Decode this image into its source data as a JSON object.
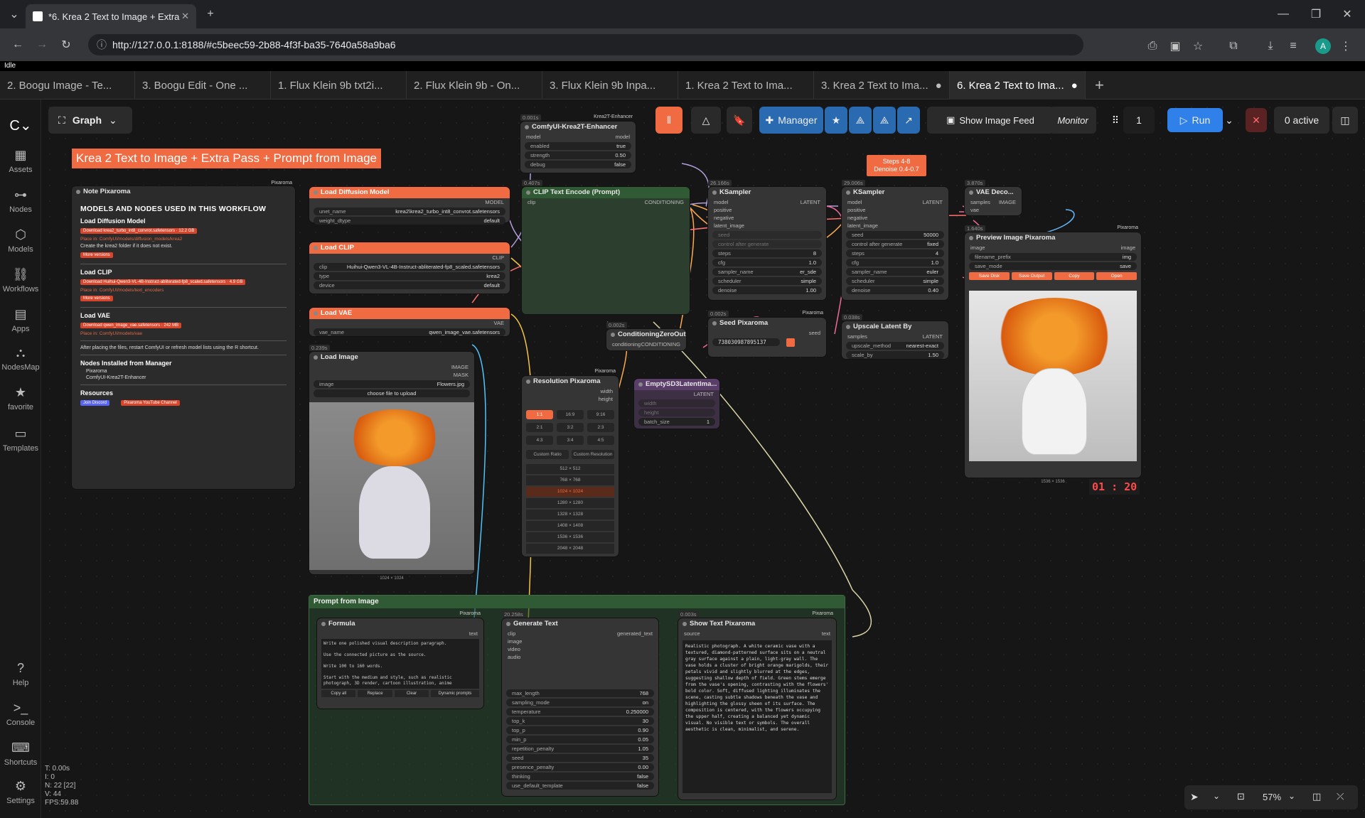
{
  "browser": {
    "tab_title": "*6. Krea 2 Text to Image + Extra",
    "url": "http://127.0.0.1:8188/#c5beec59-2b88-4f3f-ba35-7640a58a9ba6",
    "profile_initial": "A"
  },
  "status_text": "Idle",
  "workflow_tabs": [
    "2. Boogu Image - Te...",
    "3. Boogu Edit - One ...",
    "1. Flux Klein 9b txt2i...",
    "2. Flux Klein 9b - On...",
    "3. Flux Klein 9b Inpa...",
    "1. Krea 2 Text to Ima...",
    "3. Krea 2 Text to Ima...",
    "6. Krea 2 Text to Ima..."
  ],
  "sidebar": [
    {
      "label": "Assets",
      "icon": "assets-icon"
    },
    {
      "label": "Nodes",
      "icon": "nodes-icon"
    },
    {
      "label": "Models",
      "icon": "models-icon"
    },
    {
      "label": "Workflows",
      "icon": "workflows-icon"
    },
    {
      "label": "Apps",
      "icon": "apps-icon"
    },
    {
      "label": "NodesMap",
      "icon": "nodesmap-icon"
    },
    {
      "label": "favorite",
      "icon": "star-icon"
    },
    {
      "label": "Templates",
      "icon": "templates-icon"
    }
  ],
  "sidebar_bottom": [
    {
      "label": "Help"
    },
    {
      "label": "Console"
    },
    {
      "label": "Shortcuts"
    },
    {
      "label": "Settings"
    }
  ],
  "graph_label": "Graph",
  "toolbar": {
    "manager": "Manager",
    "feed": "Show Image Feed",
    "monitor": "Monitor",
    "queue_count": "1",
    "run": "Run",
    "active": "0 active"
  },
  "title_banner": "Krea 2 Text to Image + Extra Pass + Prompt from Image",
  "note": {
    "header": "Note Pixaroma",
    "brand": "Pixaroma",
    "heading": "MODELS AND NODES USED IN THIS WORKFLOW",
    "s1": "Load Diffusion Model",
    "s1_dl": "Download krea2_turbo_int8_convrot.safetensors · 12.2 GB",
    "s1_place": "Place in: ComfyUI/models/diffusion_models/krea2",
    "s1_note": "Create the  krea2  folder if it does not exist.",
    "more": "More versions",
    "s2": "Load CLIP",
    "s2_dl": "Download Huihui-Qwen3-VL-4B-Instruct-abliterated-fp8_scaled.safetensors · 4.9 GB",
    "s2_place": "Place in: ComfyUI/models/text_encoders",
    "s3": "Load VAE",
    "s3_dl": "Download qwen_image_vae.safetensors · 242 MB",
    "s3_place": "Place in: ComfyUI/models/vae",
    "warn": "After placing the files, restart ComfyUI or refresh model lists using the R shortcut.",
    "s4": "Nodes Installed from Manager",
    "n1": "Pixaroma",
    "n2": "ComfyUI-Krea2T-Enhancer",
    "s5": "Resources",
    "r1": "Join Discord",
    "r2": "Pixaroma YouTube Channel"
  },
  "nodes": {
    "enhancer": {
      "title": "ComfyUI-Krea2T-Enhancer",
      "time": "0.001s",
      "brand": "Krea2T-Enhancer",
      "in": "model",
      "out": "model",
      "enabled": "true",
      "strength": "0.50",
      "debug": "false"
    },
    "load_diff": {
      "title": "Load Diffusion Model",
      "out": "MODEL",
      "unet_name": "krea2\\krea2_turbo_int8_convrot.safetensors",
      "weight_dtype": "default"
    },
    "load_clip": {
      "title": "Load CLIP",
      "out": "CLIP",
      "clip_name": "Huihui-Qwen3-VL-4B-Instruct-abliterated-fp8_scaled.safetensors",
      "type": "krea2",
      "device": "default"
    },
    "load_vae": {
      "title": "Load VAE",
      "out": "VAE",
      "vae_name": "qwen_image_vae.safetensors"
    },
    "load_image": {
      "title": "Load Image",
      "time": "0.239s",
      "out1": "IMAGE",
      "out2": "MASK",
      "image": "Flowers.jpg",
      "upload": "choose file to upload",
      "size": "1024 × 1024"
    },
    "clip_enc": {
      "title": "CLIP Text Encode (Prompt)",
      "time": "0.407s",
      "in": "clip",
      "out": "CONDITIONING"
    },
    "cond_zero": {
      "title": "ConditioningZeroOut",
      "time": "0.002s",
      "in": "conditioning",
      "out": "CONDITIONING"
    },
    "ksampler1": {
      "title": "KSampler",
      "time": "26.166s",
      "in": [
        "model",
        "positive",
        "negative",
        "latent_image"
      ],
      "out": "LATENT",
      "seed": "seed",
      "cag": "control after generate",
      "steps": "8",
      "cfg": "1.0",
      "sampler_name": "er_sde",
      "scheduler": "simple",
      "denoise": "1.00"
    },
    "seed": {
      "title": "Seed Pixaroma",
      "time": "0.002s",
      "brand": "Pixaroma",
      "out": "seed",
      "value": "738030987895137"
    },
    "ksampler2": {
      "title": "KSampler",
      "time": "29.006s",
      "in": [
        "model",
        "positive",
        "negative",
        "latent_image"
      ],
      "out": "LATENT",
      "seed": "50000",
      "cag": "fixed",
      "steps": "4",
      "cfg": "1.0",
      "sampler_name": "euler",
      "scheduler": "simple",
      "denoise": "0.40"
    },
    "steps_note": "Steps 4-8\nDenoise 0.4-0.7",
    "upscale": {
      "title": "Upscale Latent By",
      "time": "0.038s",
      "in": "samples",
      "out": "LATENT",
      "upscale_method": "nearest-exact",
      "scale_by": "1.50"
    },
    "vae_dec": {
      "title": "VAE Deco...",
      "time": "3.870s",
      "in1": "samples",
      "in2": "vae",
      "out": "IMAGE"
    },
    "preview": {
      "title": "Preview Image Pixaroma",
      "time": "1.640s",
      "brand": "Pixaroma",
      "in": "image",
      "out": "image",
      "filename_prefix": "img",
      "save_mode": "save",
      "b1": "Save Disk",
      "b2": "Save Output",
      "b3": "Copy",
      "b4": "Open",
      "size": "1536 × 1536"
    },
    "resolution": {
      "title": "Resolution Pixaroma",
      "brand": "Pixaroma",
      "out1": "width",
      "out2": "height",
      "ratios": [
        "1:1",
        "16:9",
        "9:16",
        "2:1",
        "3:2",
        "2:3",
        "4:3",
        "3:4",
        "4:5"
      ],
      "custom1": "Custom Ratio",
      "custom2": "Custom Resolution",
      "sizes": [
        "512 × 512",
        "768 × 768",
        "1024 × 1024",
        "1280 × 1280",
        "1328 × 1328",
        "1408 × 1408",
        "1536 × 1536",
        "2048 × 2048"
      ]
    },
    "empty_latent": {
      "title": "EmptySD3LatentIma...",
      "out": "LATENT",
      "w": "width",
      "h": "height",
      "batch_size": "1"
    }
  },
  "group": {
    "title": "Prompt from Image",
    "formula": {
      "title": "Formula",
      "brand": "Pixaroma",
      "out": "text",
      "text": "Write one polished visual description paragraph.\n\nUse the connected picture as the source.\n\nWrite 100 to 160 words.\n\nStart with the medium and style, such as realistic photograph, 3D render, cartoon illustration, anime",
      "b1": "Copy all",
      "b2": "Replace",
      "b3": "Clear",
      "b4": "Dynamic prompts"
    },
    "gen": {
      "title": "Generate Text",
      "time": "20.258s",
      "in": [
        "clip",
        "image",
        "video",
        "audio"
      ],
      "out": "generated_text",
      "params": [
        [
          "max_length",
          "768"
        ],
        [
          "sampling_mode",
          "on"
        ],
        [
          "temperature",
          "0.250000"
        ],
        [
          "top_k",
          "30"
        ],
        [
          "top_p",
          "0.90"
        ],
        [
          "min_p",
          "0.05"
        ],
        [
          "repetition_penalty",
          "1.05"
        ],
        [
          "seed",
          "35"
        ],
        [
          "presence_penalty",
          "0.00"
        ],
        [
          "thinking",
          "false"
        ],
        [
          "use_default_template",
          "false"
        ]
      ]
    },
    "show": {
      "title": "Show Text Pixaroma",
      "time": "0.003s",
      "brand": "Pixaroma",
      "in": "source",
      "out": "text",
      "text": "Realistic photograph. A white ceramic vase with a textured, diamond-patterned surface sits on a neutral gray surface against a plain, light-gray wall. The vase holds a cluster of bright orange marigolds, their petals vivid and slightly blurred at the edges, suggesting shallow depth of field. Green stems emerge from the vase's opening, contrasting with the flowers' bold color. Soft, diffused lighting illuminates the scene, casting subtle shadows beneath the vase and highlighting the glossy sheen of its surface. The composition is centered, with the flowers occupying the upper half, creating a balanced yet dynamic visual. No visible text or symbols. The overall aesthetic is clean, minimalist, and serene."
    }
  },
  "timer": "01 : 20",
  "stats": [
    "T: 0.00s",
    "I: 0",
    "N: 22 [22]",
    "V: 44",
    "FPS:59.88"
  ],
  "zoom": "57%"
}
